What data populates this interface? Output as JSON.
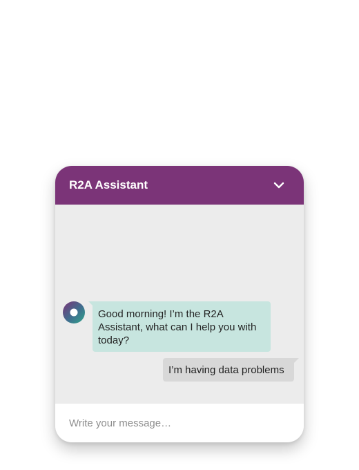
{
  "header": {
    "title": "R2A Assistant",
    "collapse_icon": "chevron-down-icon",
    "background_color": "#7b3478"
  },
  "messages": [
    {
      "sender": "bot",
      "avatar_icon": "bot-avatar-icon",
      "text": "Good morning! I’m the R2A Assistant, what can I help you with today?",
      "bubble_color": "#c7e5df"
    },
    {
      "sender": "user",
      "text": "I’m having data problems",
      "bubble_color": "#d8d8d8"
    }
  ],
  "composer": {
    "value": "",
    "placeholder": "Write your message…"
  }
}
